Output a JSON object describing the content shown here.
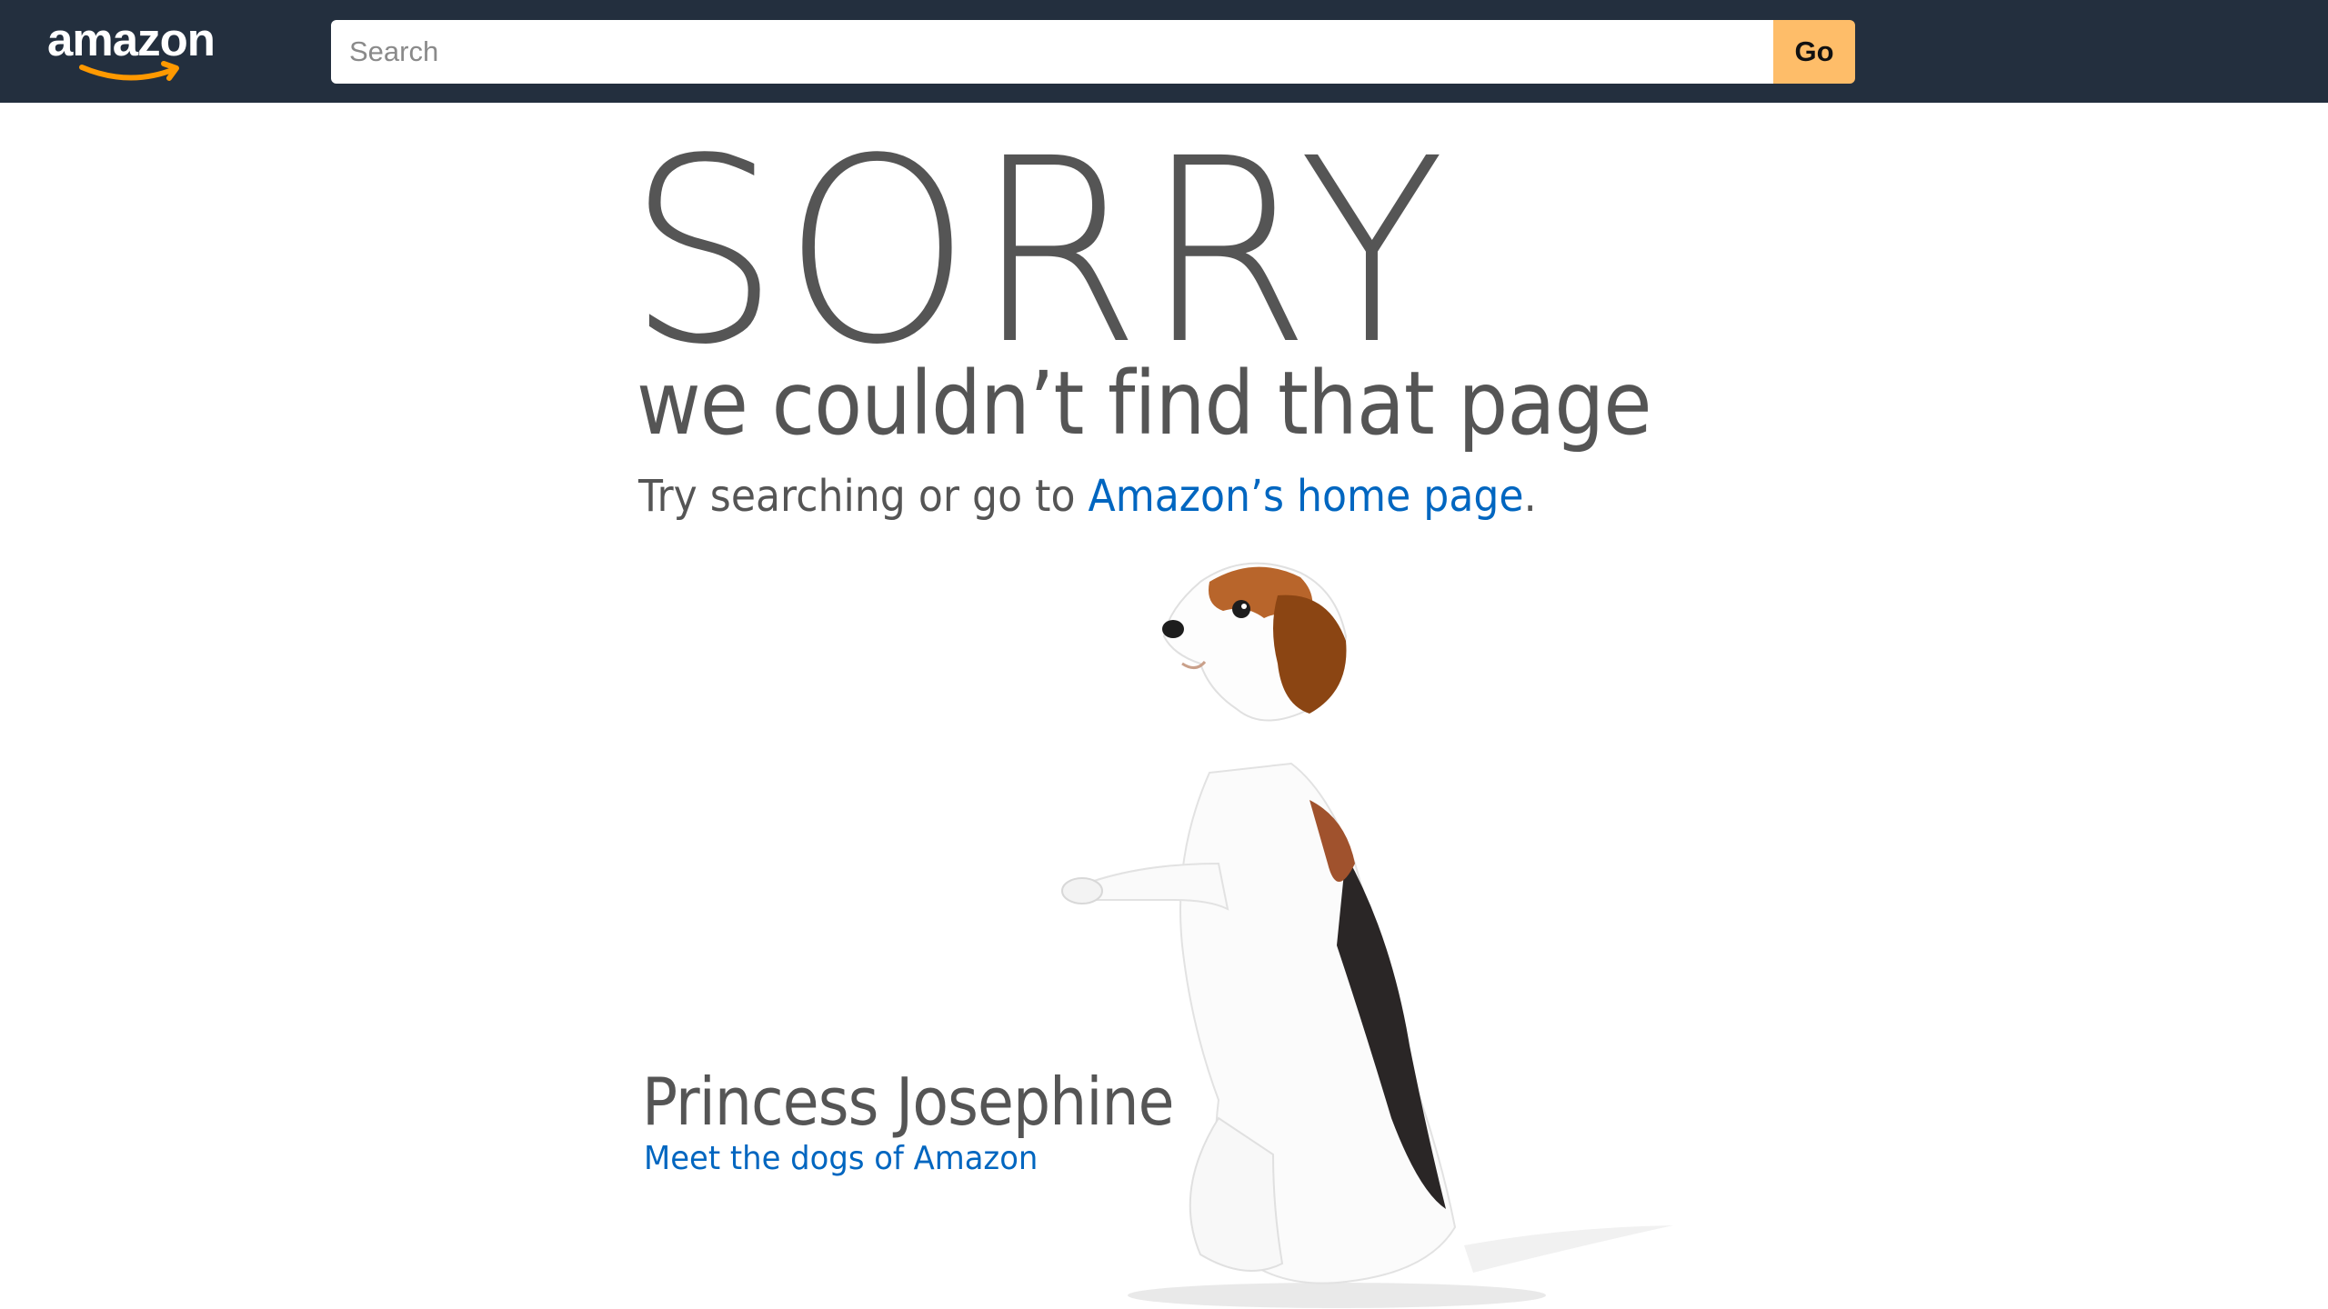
{
  "header": {
    "logo_text": "amazon",
    "search": {
      "placeholder": "Search",
      "value": ""
    },
    "go_label": "Go",
    "colors": {
      "background": "#232f3e",
      "go_button": "#febd69"
    }
  },
  "error": {
    "headline": "SORRY",
    "subtitle": "we couldn’t find that page",
    "try_prefix": "Try searching or go to ",
    "home_link": "Amazon’s home page",
    "try_suffix": "."
  },
  "dog": {
    "name": "Princess Josephine",
    "link": "Meet the dogs of Amazon",
    "image": "beagle-standing-photo"
  },
  "colors": {
    "text": "#555555",
    "link": "#0066c0"
  }
}
